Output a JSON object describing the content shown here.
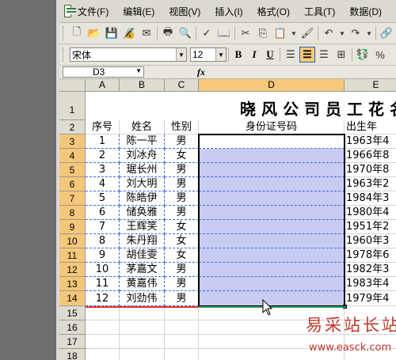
{
  "menu": [
    "文件(F)",
    "编辑(E)",
    "视图(V)",
    "插入(I)",
    "格式(O)",
    "工具(T)",
    "数据(D)"
  ],
  "toolbar": {
    "font_name": "宋体",
    "font_size": "12",
    "bold": "B",
    "italic": "I",
    "underline": "U",
    "percent": "%"
  },
  "formula_bar": {
    "name_box": "D3",
    "fx": "fx",
    "formula": ""
  },
  "columns": [
    "A",
    "B",
    "C",
    "D",
    "E"
  ],
  "rows": [
    "1",
    "2",
    "3",
    "4",
    "5",
    "6",
    "7",
    "8",
    "9",
    "10",
    "11",
    "12",
    "13",
    "14",
    "15",
    "16",
    "17",
    "18"
  ],
  "sheet": {
    "title": "晓风公司员工花名册",
    "headers": [
      "序号",
      "姓名",
      "性别",
      "身份证号码",
      "出生年"
    ],
    "records": [
      [
        "1",
        "陈一平",
        "男",
        "",
        "1963年4"
      ],
      [
        "2",
        "刘冰舟",
        "女",
        "",
        "1966年8"
      ],
      [
        "3",
        "琚长州",
        "男",
        "",
        "1970年8"
      ],
      [
        "4",
        "刘大明",
        "男",
        "",
        "1963年2"
      ],
      [
        "5",
        "陈皓伊",
        "男",
        "",
        "1984年3"
      ],
      [
        "6",
        "储奂雅",
        "男",
        "",
        "1980年4"
      ],
      [
        "7",
        "王辉笑",
        "女",
        "",
        "1951年2"
      ],
      [
        "8",
        "朱丹翔",
        "女",
        "",
        "1960年3"
      ],
      [
        "9",
        "胡佳雯",
        "女",
        "",
        "1978年6"
      ],
      [
        "10",
        "茅嘉文",
        "男",
        "",
        "1982年3"
      ],
      [
        "11",
        "黄嘉伟",
        "男",
        "",
        "1983年4"
      ],
      [
        "12",
        "刘劲伟",
        "男",
        "",
        "1979年4"
      ]
    ]
  },
  "watermark": {
    "title": "易采站长站",
    "url": "www.easck.com"
  }
}
